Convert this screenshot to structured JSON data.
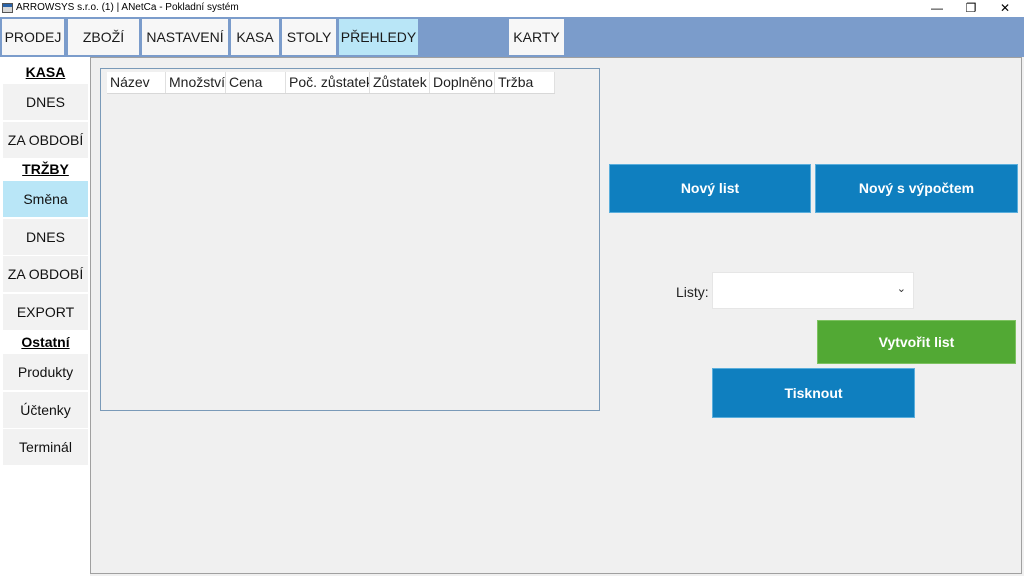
{
  "window": {
    "title": "ARROWSYS s.r.o. (1) | ANetCa - Pokladní systém",
    "minimize": "—",
    "restore": "❐",
    "close": "✕"
  },
  "nav": {
    "tabs": [
      {
        "label": "PRODEJ"
      },
      {
        "label": "ZBOŽÍ"
      },
      {
        "label": "NASTAVENÍ"
      },
      {
        "label": "KASA"
      },
      {
        "label": "STOLY"
      },
      {
        "label": "PŘEHLEDY",
        "active": true
      },
      {
        "label": "KARTY"
      }
    ]
  },
  "sidebar": {
    "kasa_heading": "KASA",
    "kasa_items": [
      {
        "label": "DNES"
      },
      {
        "label": "ZA OBDOBÍ"
      }
    ],
    "trzby_heading": "TRŽBY",
    "trzby_items": [
      {
        "label": "Směna",
        "active": true
      },
      {
        "label": "DNES"
      },
      {
        "label": "ZA OBDOBÍ"
      },
      {
        "label": "EXPORT"
      }
    ],
    "ostatni_heading": "Ostatní",
    "ostatni_items": [
      {
        "label": "Produkty"
      },
      {
        "label": "Účtenky"
      },
      {
        "label": "Terminál"
      }
    ]
  },
  "grid": {
    "columns": [
      "Název",
      "Množství",
      "Cena",
      "Poč. zůstatek",
      "Zůstatek",
      "Doplněno",
      "Tržba"
    ],
    "rows": []
  },
  "actions": {
    "new_sheet": "Nový list",
    "new_with_calc": "Nový s výpočtem",
    "sheets_label": "Listy:",
    "sheets_value": "",
    "create_sheet": "Vytvořit list",
    "print": "Tisknout"
  },
  "colors": {
    "nav_bar": "#7b9ccb",
    "active_tab": "#b9e6f7",
    "primary_button": "#0f7fbf",
    "success_button": "#52a934"
  }
}
